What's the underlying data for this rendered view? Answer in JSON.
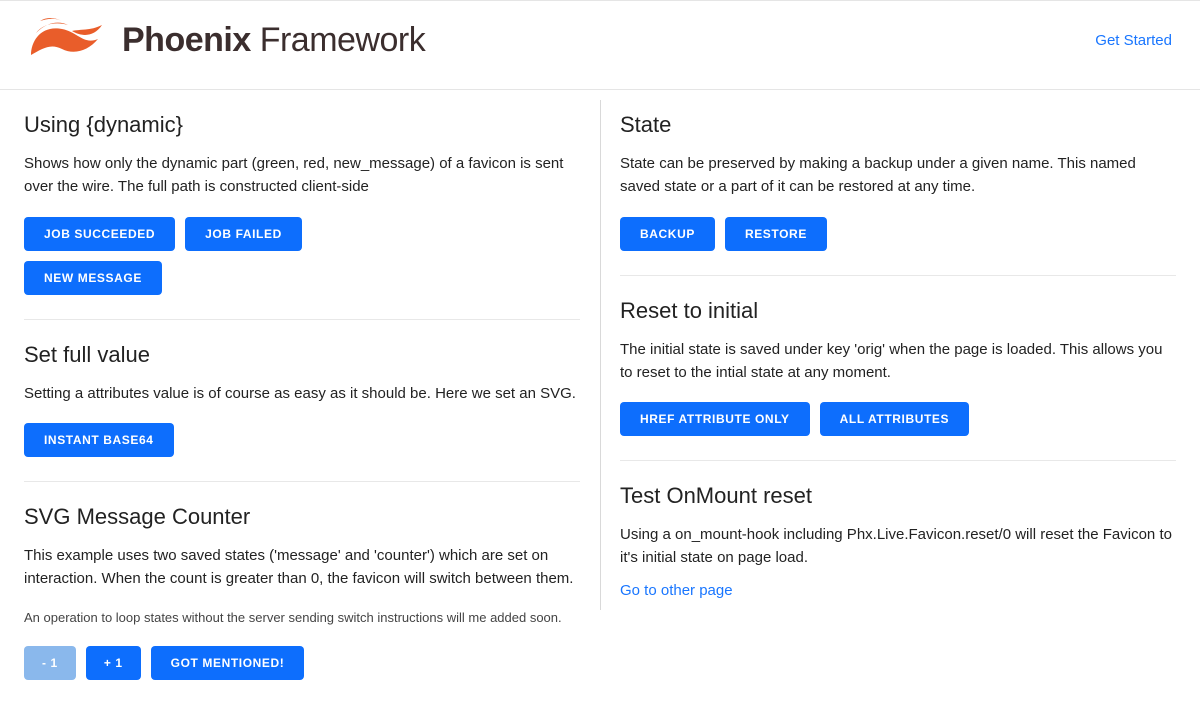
{
  "header": {
    "brand_bold": "Phoenix",
    "brand_light": " Framework",
    "get_started": "Get Started"
  },
  "left": {
    "dynamic": {
      "title": "Using {dynamic}",
      "desc": "Shows how only the dynamic part (green, red, new_message) of a favicon is sent over the wire. The full path is constructed client-side",
      "buttons": {
        "job_succeeded": "Job Succeeded",
        "job_failed": "Job Failed",
        "new_message": "New Message"
      }
    },
    "full_value": {
      "title": "Set full value",
      "desc": "Setting a attributes value is of course as easy as it should be. Here we set an SVG.",
      "buttons": {
        "instant_base64": "Instant Base64"
      }
    },
    "svg_counter": {
      "title": "SVG Message Counter",
      "desc": "This example uses two saved states ('message' and 'counter') which are set on interaction. When the count is greater than 0, the favicon will switch between them.",
      "caption": "An operation to loop states without the server sending switch instructions will me added soon.",
      "buttons": {
        "minus_one": "- 1",
        "plus_one": "+ 1",
        "got_mentioned": "Got Mentioned!"
      }
    }
  },
  "right": {
    "state": {
      "title": "State",
      "desc": "State can be preserved by making a backup under a given name. This named saved state or a part of it can be restored at any time.",
      "buttons": {
        "backup": "Backup",
        "restore": "Restore"
      }
    },
    "reset": {
      "title": "Reset to initial",
      "desc": "The initial state is saved under key 'orig' when the page is loaded. This allows you to reset to the intial state at any moment.",
      "buttons": {
        "href_only": "Href Attribute Only",
        "all_attrs": "All Attributes"
      }
    },
    "onmount": {
      "title": "Test OnMount reset",
      "desc": "Using a on_mount-hook including Phx.Live.Favicon.reset/0 will reset the Favicon to it's initial state on page load.",
      "link": "Go to other page"
    }
  }
}
